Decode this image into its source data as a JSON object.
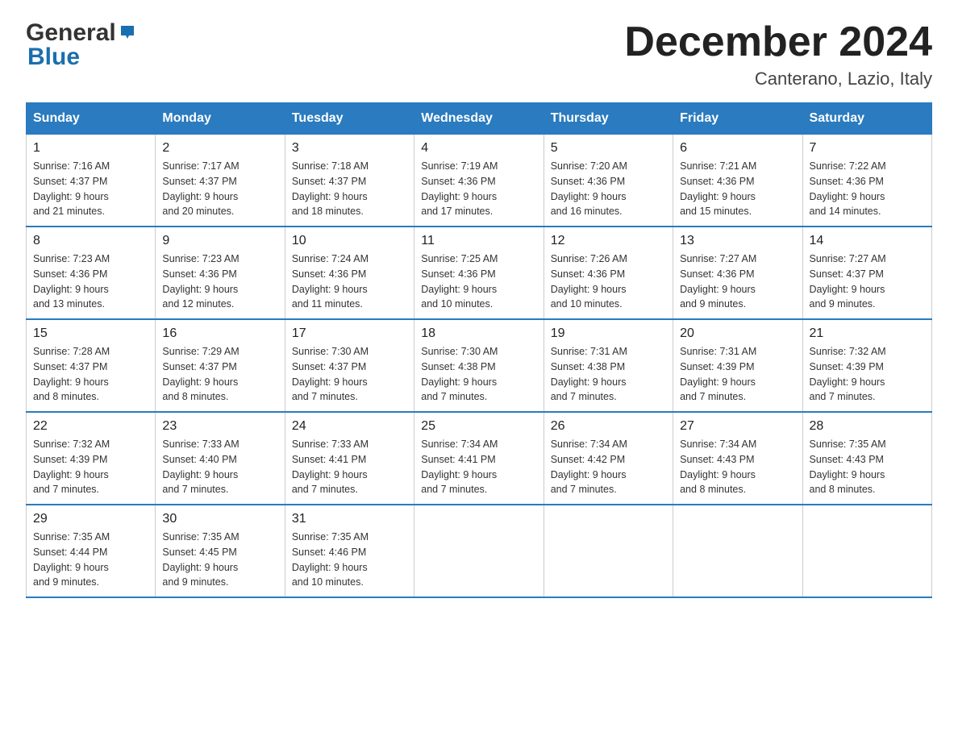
{
  "header": {
    "logo_text1": "General",
    "logo_text2": "Blue",
    "title": "December 2024",
    "subtitle": "Canterano, Lazio, Italy"
  },
  "calendar": {
    "days_of_week": [
      "Sunday",
      "Monday",
      "Tuesday",
      "Wednesday",
      "Thursday",
      "Friday",
      "Saturday"
    ],
    "weeks": [
      [
        {
          "date": "1",
          "sunrise": "7:16 AM",
          "sunset": "4:37 PM",
          "daylight": "9 hours and 21 minutes."
        },
        {
          "date": "2",
          "sunrise": "7:17 AM",
          "sunset": "4:37 PM",
          "daylight": "9 hours and 20 minutes."
        },
        {
          "date": "3",
          "sunrise": "7:18 AM",
          "sunset": "4:37 PM",
          "daylight": "9 hours and 18 minutes."
        },
        {
          "date": "4",
          "sunrise": "7:19 AM",
          "sunset": "4:36 PM",
          "daylight": "9 hours and 17 minutes."
        },
        {
          "date": "5",
          "sunrise": "7:20 AM",
          "sunset": "4:36 PM",
          "daylight": "9 hours and 16 minutes."
        },
        {
          "date": "6",
          "sunrise": "7:21 AM",
          "sunset": "4:36 PM",
          "daylight": "9 hours and 15 minutes."
        },
        {
          "date": "7",
          "sunrise": "7:22 AM",
          "sunset": "4:36 PM",
          "daylight": "9 hours and 14 minutes."
        }
      ],
      [
        {
          "date": "8",
          "sunrise": "7:23 AM",
          "sunset": "4:36 PM",
          "daylight": "9 hours and 13 minutes."
        },
        {
          "date": "9",
          "sunrise": "7:23 AM",
          "sunset": "4:36 PM",
          "daylight": "9 hours and 12 minutes."
        },
        {
          "date": "10",
          "sunrise": "7:24 AM",
          "sunset": "4:36 PM",
          "daylight": "9 hours and 11 minutes."
        },
        {
          "date": "11",
          "sunrise": "7:25 AM",
          "sunset": "4:36 PM",
          "daylight": "9 hours and 10 minutes."
        },
        {
          "date": "12",
          "sunrise": "7:26 AM",
          "sunset": "4:36 PM",
          "daylight": "9 hours and 10 minutes."
        },
        {
          "date": "13",
          "sunrise": "7:27 AM",
          "sunset": "4:36 PM",
          "daylight": "9 hours and 9 minutes."
        },
        {
          "date": "14",
          "sunrise": "7:27 AM",
          "sunset": "4:37 PM",
          "daylight": "9 hours and 9 minutes."
        }
      ],
      [
        {
          "date": "15",
          "sunrise": "7:28 AM",
          "sunset": "4:37 PM",
          "daylight": "9 hours and 8 minutes."
        },
        {
          "date": "16",
          "sunrise": "7:29 AM",
          "sunset": "4:37 PM",
          "daylight": "9 hours and 8 minutes."
        },
        {
          "date": "17",
          "sunrise": "7:30 AM",
          "sunset": "4:37 PM",
          "daylight": "9 hours and 7 minutes."
        },
        {
          "date": "18",
          "sunrise": "7:30 AM",
          "sunset": "4:38 PM",
          "daylight": "9 hours and 7 minutes."
        },
        {
          "date": "19",
          "sunrise": "7:31 AM",
          "sunset": "4:38 PM",
          "daylight": "9 hours and 7 minutes."
        },
        {
          "date": "20",
          "sunrise": "7:31 AM",
          "sunset": "4:39 PM",
          "daylight": "9 hours and 7 minutes."
        },
        {
          "date": "21",
          "sunrise": "7:32 AM",
          "sunset": "4:39 PM",
          "daylight": "9 hours and 7 minutes."
        }
      ],
      [
        {
          "date": "22",
          "sunrise": "7:32 AM",
          "sunset": "4:39 PM",
          "daylight": "9 hours and 7 minutes."
        },
        {
          "date": "23",
          "sunrise": "7:33 AM",
          "sunset": "4:40 PM",
          "daylight": "9 hours and 7 minutes."
        },
        {
          "date": "24",
          "sunrise": "7:33 AM",
          "sunset": "4:41 PM",
          "daylight": "9 hours and 7 minutes."
        },
        {
          "date": "25",
          "sunrise": "7:34 AM",
          "sunset": "4:41 PM",
          "daylight": "9 hours and 7 minutes."
        },
        {
          "date": "26",
          "sunrise": "7:34 AM",
          "sunset": "4:42 PM",
          "daylight": "9 hours and 7 minutes."
        },
        {
          "date": "27",
          "sunrise": "7:34 AM",
          "sunset": "4:43 PM",
          "daylight": "9 hours and 8 minutes."
        },
        {
          "date": "28",
          "sunrise": "7:35 AM",
          "sunset": "4:43 PM",
          "daylight": "9 hours and 8 minutes."
        }
      ],
      [
        {
          "date": "29",
          "sunrise": "7:35 AM",
          "sunset": "4:44 PM",
          "daylight": "9 hours and 9 minutes."
        },
        {
          "date": "30",
          "sunrise": "7:35 AM",
          "sunset": "4:45 PM",
          "daylight": "9 hours and 9 minutes."
        },
        {
          "date": "31",
          "sunrise": "7:35 AM",
          "sunset": "4:46 PM",
          "daylight": "9 hours and 10 minutes."
        },
        null,
        null,
        null,
        null
      ]
    ],
    "labels": {
      "sunrise": "Sunrise:",
      "sunset": "Sunset:",
      "daylight": "Daylight:"
    }
  }
}
